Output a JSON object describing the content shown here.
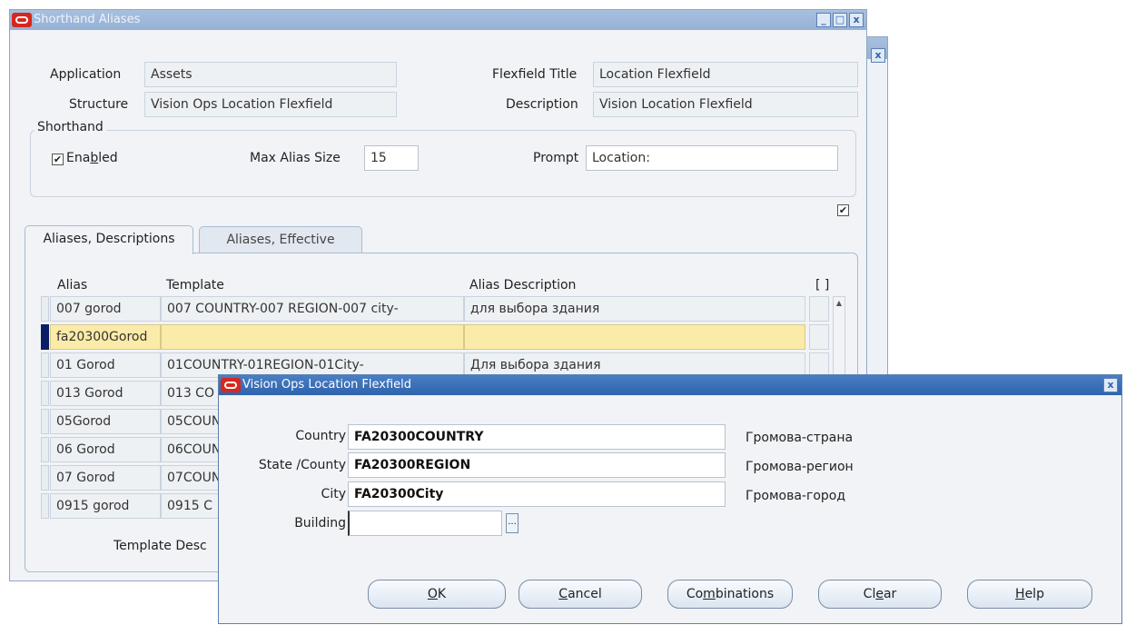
{
  "main_window": {
    "title": "Shorthand Aliases",
    "controls": [
      "_",
      "□",
      "x"
    ],
    "application_label": "Application",
    "application_value": "Assets",
    "structure_label": "Structure",
    "structure_value": "Vision Ops Location Flexfield",
    "flexfield_title_label": "Flexfield Title",
    "flexfield_title_value": "Location Flexfield",
    "description_label": "Description",
    "description_value": "Vision Location Flexfield",
    "shorthand_group_label": "Shorthand",
    "enabled_label_pre": "Ena",
    "enabled_label_u": "b",
    "enabled_label_post": "led",
    "enabled_checked": true,
    "max_alias_size_label": "Max Alias Size",
    "max_alias_size_value": "15",
    "prompt_label": "Prompt",
    "prompt_value": "Location:",
    "tabs": [
      "Aliases, Descriptions",
      "Aliases, Effective"
    ],
    "columns": {
      "alias": "Alias",
      "template": "Template",
      "alias_description": "Alias Description",
      "flag": "[ ]"
    },
    "rows": [
      {
        "alias": "007 gorod",
        "template": "007 COUNTRY-007 REGION-007 city-",
        "description": "для выбора здания"
      },
      {
        "alias": "fa20300Gorod",
        "template": "",
        "description": ""
      },
      {
        "alias": "01 Gorod",
        "template": "01COUNTRY-01REGION-01City-",
        "description": "Для выбора здания"
      },
      {
        "alias": "013 Gorod",
        "template": "013 CO",
        "description": ""
      },
      {
        "alias": "05Gorod",
        "template": "05COUN",
        "description": ""
      },
      {
        "alias": "06 Gorod",
        "template": "06COUN",
        "description": ""
      },
      {
        "alias": "07 Gorod",
        "template": "07COUN",
        "description": ""
      },
      {
        "alias": "0915 gorod",
        "template": "0915 C",
        "description": ""
      }
    ],
    "template_desc_label": "Template Desc"
  },
  "dialog": {
    "title": "Vision Ops Location Flexfield",
    "country_label": "Country",
    "country_value": "FA20300COUNTRY",
    "country_desc": "Громова-страна",
    "state_label": "State /County",
    "state_value": "FA20300REGION",
    "state_desc": "Громова-регион",
    "city_label": "City",
    "city_value": "FA20300City",
    "city_desc": "Громова-город",
    "building_label": "Building",
    "building_value": "",
    "lov_button": "...",
    "buttons": {
      "ok_u": "O",
      "ok_rest": "K",
      "cancel_u": "C",
      "cancel_rest": "ancel",
      "combinations_pre": "Co",
      "combinations_u": "m",
      "combinations_post": "binations",
      "clear_pre": "Cl",
      "clear_u": "e",
      "clear_post": "ar",
      "help_u": "H",
      "help_rest": "elp"
    }
  }
}
